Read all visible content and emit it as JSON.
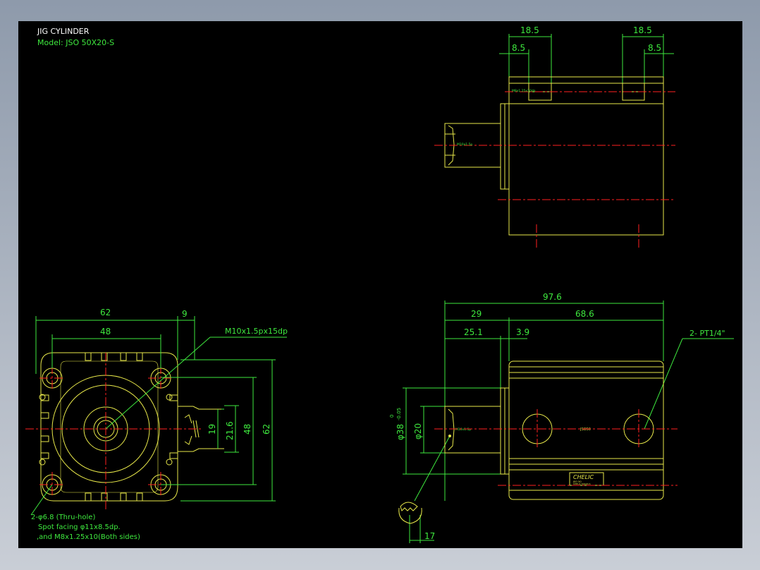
{
  "title": {
    "line1": "JIG CYLINDER",
    "line2": "Model: JSO 50X20-S"
  },
  "colors": {
    "background": "#000000",
    "outline": "#e8e84a",
    "dimension": "#3ee83e",
    "centerline": "#ff2020",
    "text_white": "#ffffff"
  },
  "top_view": {
    "dim_left_outer": "18.5",
    "dim_left_inner": "8.5",
    "dim_right_outer": "18.5",
    "dim_right_inner": "8.5",
    "port_label_left": "M8x1.25x10dp",
    "rod_label": "M10x1.5p"
  },
  "front_view": {
    "dim_width_overall": "62",
    "dim_width_bolt": "48",
    "dim_side": "9",
    "dim_height_19": "19",
    "dim_height_21_6": "21.6",
    "dim_height_48": "48",
    "dim_height_62": "62",
    "callout_thread": "M10x1.5px15dp",
    "note_line1": "2-φ6.8 (Thru-hole)",
    "note_line2": "Spot facing  φ11x8.5dp.",
    "note_line3": ",and  M8x1.25x10(Both sides)"
  },
  "side_view": {
    "dim_overall": "97.6",
    "dim_29": "29",
    "dim_68_6": "68.6",
    "dim_25_1": "25.1",
    "dim_3_9": "3.9",
    "port_callout": "2- PT1/4\"",
    "dim_dia38": "φ38",
    "dim_dia38_tol": "-0.05",
    "dim_dia38_tol_upper": "0",
    "dim_dia20": "φ20",
    "dim_17": "17",
    "body_label": "JSO50",
    "rod_label": "M10x1.5p",
    "plate_brand": "CHELIC",
    "plate_model": "JSO 50",
    "plate_sub": "CHELIC 50X20-S"
  }
}
